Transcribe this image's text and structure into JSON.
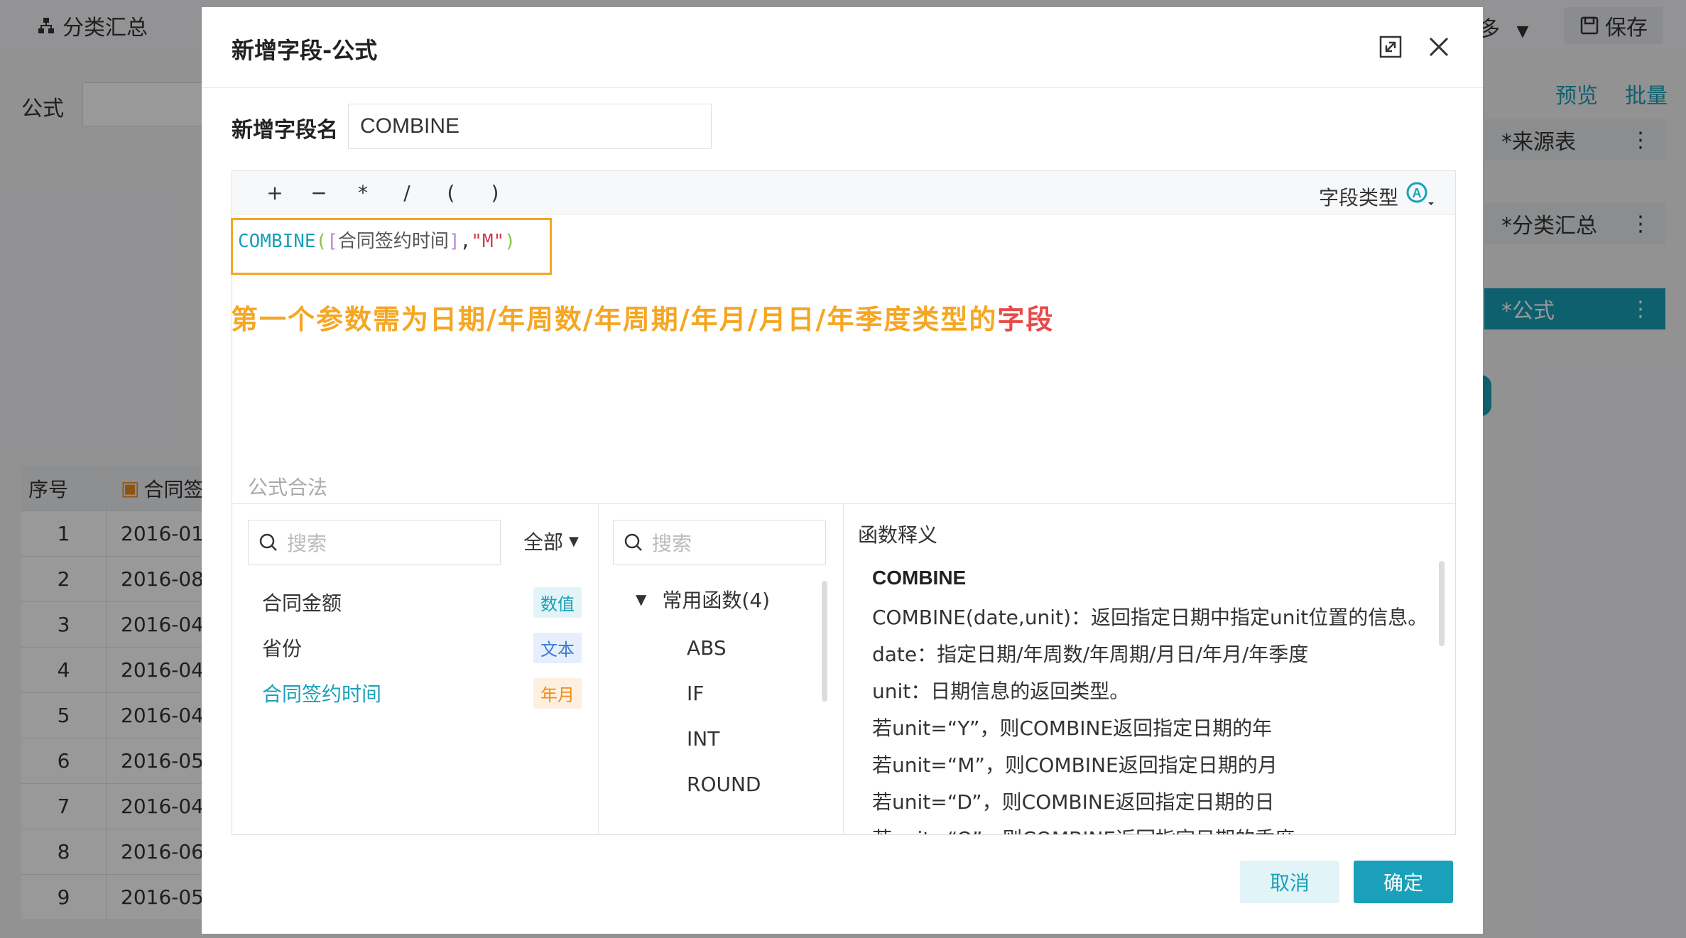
{
  "background": {
    "title": "分类汇总",
    "more": "多",
    "save": "保存",
    "formula_label": "公式",
    "preview": "预览",
    "batch": "批量",
    "steps": [
      {
        "label": "*来源表"
      },
      {
        "label": "*分类汇总"
      },
      {
        "label": "*公式"
      }
    ],
    "table": {
      "head_index": "序号",
      "head_col": "合同签",
      "rows": [
        {
          "idx": "1",
          "val": "2016-01"
        },
        {
          "idx": "2",
          "val": "2016-08"
        },
        {
          "idx": "3",
          "val": "2016-04"
        },
        {
          "idx": "4",
          "val": "2016-04"
        },
        {
          "idx": "5",
          "val": "2016-04"
        },
        {
          "idx": "6",
          "val": "2016-05"
        },
        {
          "idx": "7",
          "val": "2016-04"
        },
        {
          "idx": "8",
          "val": "2016-06"
        },
        {
          "idx": "9",
          "val": "2016-05"
        }
      ]
    }
  },
  "dialog": {
    "title": "新增字段-公式",
    "field_name_label": "新增字段名",
    "field_name_value": "COMBINE",
    "operators": [
      "+",
      "−",
      "*",
      "/",
      "(",
      ")"
    ],
    "field_type_label": "字段类型",
    "formula": {
      "func": "COMBINE",
      "open_paren": "(",
      "open_bracket": "[",
      "field": "合同签约时间",
      "close_bracket": "]",
      "comma": ",",
      "string": "\"M\"",
      "close_paren": ")"
    },
    "hint_main": "第一个参数需为日期/年周数/年周期/年月/月日/年季度类型的",
    "hint_red": "字段",
    "legal_text": "公式合法",
    "fields_panel": {
      "search_placeholder": "搜索",
      "filter_label": "全部",
      "items": [
        {
          "name": "合同金额",
          "tag": "数值"
        },
        {
          "name": "省份",
          "tag": "文本"
        },
        {
          "name": "合同签约时间",
          "tag": "年月"
        }
      ]
    },
    "funcs_panel": {
      "search_placeholder": "搜索",
      "group_label": "常用函数(4)",
      "items": [
        "ABS",
        "IF",
        "INT",
        "ROUND"
      ]
    },
    "desc_panel": {
      "title": "函数释义",
      "name": "COMBINE",
      "lines": [
        "COMBINE(date,unit)：返回指定日期中指定unit位置的信息。",
        "date：指定日期/年周数/年周期/月日/年月/年季度",
        "unit：日期信息的返回类型。",
        "若unit=“Y”，则COMBINE返回指定日期的年",
        "若unit=“M”，则COMBINE返回指定日期的月",
        "若unit=“D”，则COMBINE返回指定日期的日",
        "若unit=“Q”，则COMBINE返回指定日期的季度"
      ]
    },
    "cancel_label": "取消",
    "ok_label": "确定"
  }
}
